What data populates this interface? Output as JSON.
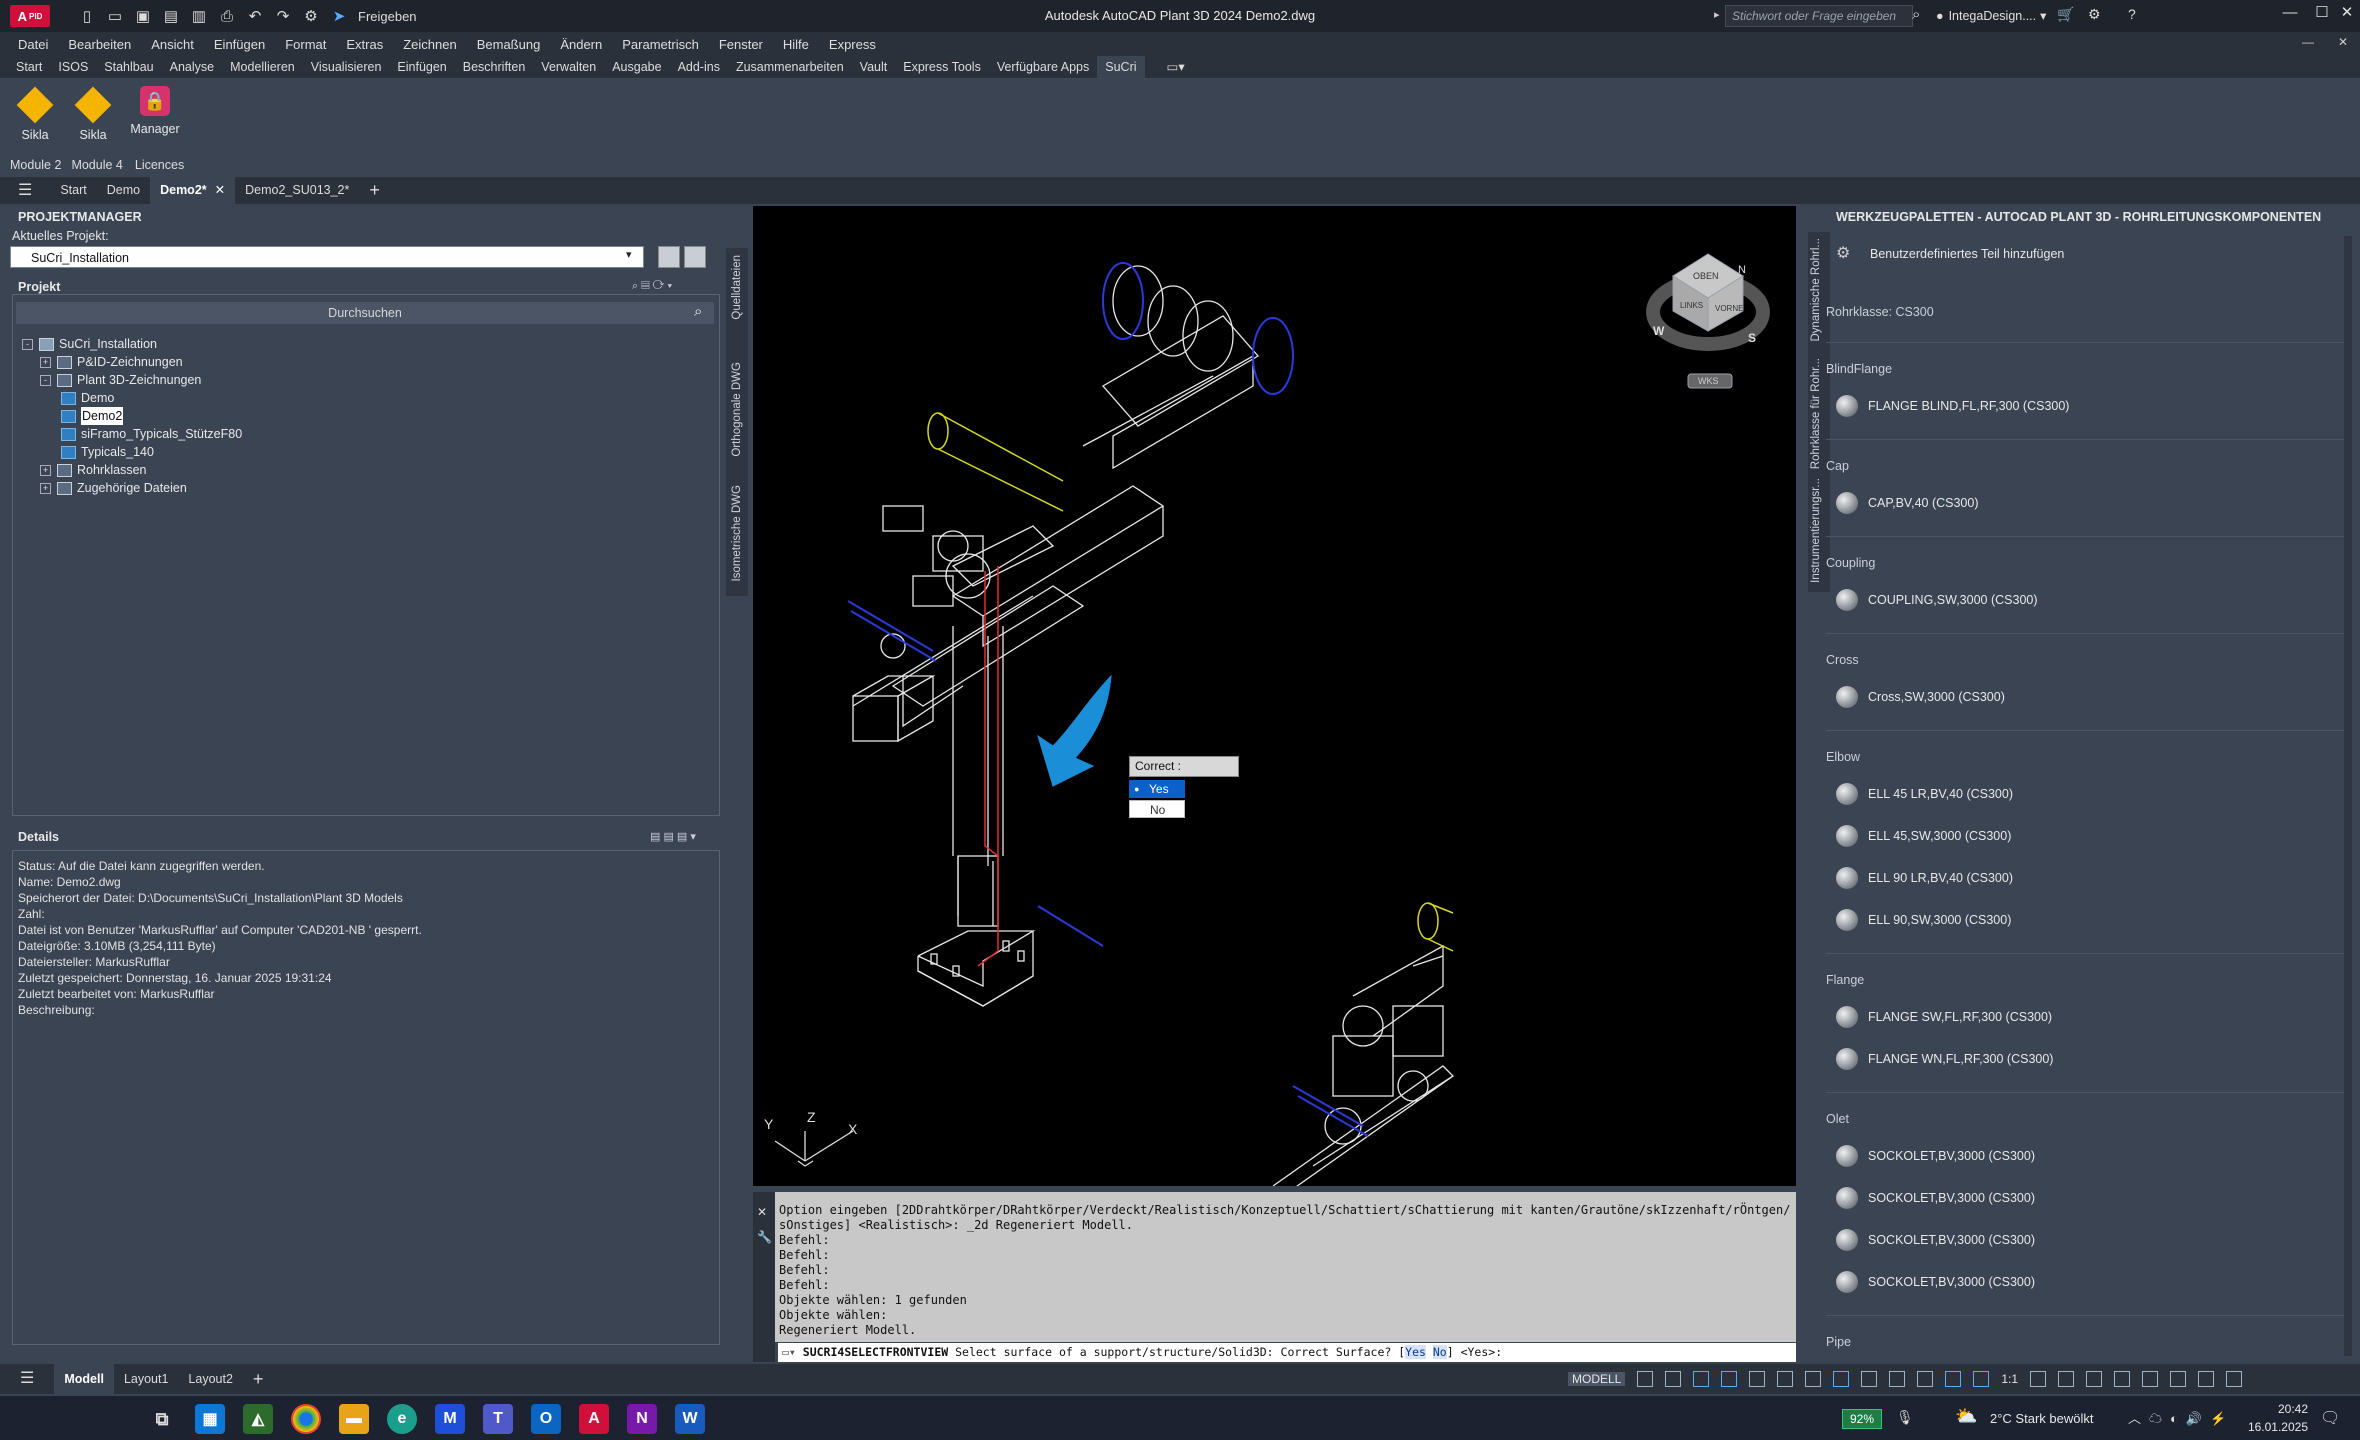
{
  "app": {
    "logo_text": "A",
    "logo_sub": "PID",
    "title": "Autodesk AutoCAD Plant 3D 2024    Demo2.dwg",
    "share_label": "Freigeben",
    "search_placeholder": "Stichwort oder Frage eingeben",
    "user": "IntegaDesign....",
    "icons": [
      "new-icon",
      "open-icon",
      "save-icon",
      "save-as-icon",
      "publish-icon",
      "print-icon",
      "undo-icon",
      "redo-icon",
      "workspace-icon",
      "share-icon"
    ]
  },
  "menubar": [
    "Datei",
    "Bearbeiten",
    "Ansicht",
    "Einfügen",
    "Format",
    "Extras",
    "Zeichnen",
    "Bemaßung",
    "Ändern",
    "Parametrisch",
    "Fenster",
    "Hilfe",
    "Express"
  ],
  "ribbon_tabs": [
    "Start",
    "ISOS",
    "Stahlbau",
    "Analyse",
    "Modellieren",
    "Visualisieren",
    "Einfügen",
    "Beschriften",
    "Verwalten",
    "Ausgabe",
    "Add-ins",
    "Zusammenarbeiten",
    "Vault",
    "Express Tools",
    "Verfügbare Apps",
    "SuCri"
  ],
  "ribbon_active": "SuCri",
  "ribbon_buttons": [
    "Sikla",
    "Sikla",
    "Manager"
  ],
  "ribbon_panels": [
    "Module 2",
    "Module 4",
    "Licences"
  ],
  "file_tabs": [
    "Start",
    "Demo",
    "Demo2*",
    "Demo2_SU013_2*"
  ],
  "file_tab_active": "Demo2*",
  "project_manager": {
    "title": "PROJEKTMANAGER",
    "current_project_label": "Aktuelles Projekt:",
    "current_project": "SuCri_Installation",
    "project_label": "Projekt",
    "search_label": "Durchsuchen",
    "tree": [
      {
        "label": "SuCri_Installation",
        "level": 0,
        "exp": "-",
        "icon": "proj"
      },
      {
        "label": "P&ID-Zeichnungen",
        "level": 1,
        "exp": "+",
        "icon": "folder"
      },
      {
        "label": "Plant 3D-Zeichnungen",
        "level": 1,
        "exp": "-",
        "icon": "folder"
      },
      {
        "label": "Demo",
        "level": 2,
        "exp": "",
        "icon": "dwg"
      },
      {
        "label": "Demo2",
        "level": 2,
        "exp": "",
        "icon": "dwg"
      },
      {
        "label": "siFramo_Typicals_StützeF80",
        "level": 2,
        "exp": "",
        "icon": "dwg"
      },
      {
        "label": "Typicals_140",
        "level": 2,
        "exp": "",
        "icon": "dwg"
      },
      {
        "label": "Rohrklassen",
        "level": 1,
        "exp": "+",
        "icon": "folder"
      },
      {
        "label": "Zugehörige Dateien",
        "level": 1,
        "exp": "+",
        "icon": "folder"
      }
    ],
    "details_label": "Details",
    "details": [
      "Status: Auf die Datei kann zugegriffen werden.",
      "Name:  Demo2.dwg",
      "Speicherort der Datei:  D:\\Documents\\SuCri_Installation\\Plant 3D Models",
      "Zahl:",
      "Datei ist von Benutzer 'MarkusRufflar' auf Computer 'CAD201-NB ' gesperrt.",
      "Dateigröße: 3.10MB (3,254,111 Byte)",
      "Dateiersteller:  MarkusRufflar",
      "Zuletzt gespeichert: Donnerstag, 16. Januar 2025 19:31:24",
      "Zuletzt bearbeitet von:  MarkusRufflar",
      "Beschreibung:"
    ],
    "side_tabs": [
      "Quelldateien",
      "Orthogonale DWG",
      "Isometrische DWG"
    ]
  },
  "viewcube": {
    "top": "OBEN",
    "left": "LINKS",
    "front": "VORNE",
    "n": "N",
    "w": "W",
    "s": "S",
    "wcs": "WKS"
  },
  "ucs": {
    "x": "X",
    "y": "Y",
    "z": "Z"
  },
  "popup": {
    "title": "Correct :",
    "yes": "Yes",
    "no": "No"
  },
  "command": {
    "lines": [
      "Option eingeben [2DDrahtkörper/DRahtkörper/Verdeckt/Realistisch/Konzeptuell/Schattiert/sChattierung mit kanten/Grautöne/skIzzenhaft/rÖntgen/",
      "sOnstiges] <Realistisch>: _2d Regeneriert Modell.",
      "Befehl:",
      "Befehl:",
      "Befehl:",
      "Befehl:",
      "Objekte wählen: 1 gefunden",
      "Objekte wählen:",
      "Regeneriert Modell."
    ],
    "prompt_cmd": "SUCRI4SELECTFRONTVIEW",
    "prompt_text": " Select surface of a support/structure/Solid3D: Correct Surface? [",
    "prompt_opt1": "Yes",
    "prompt_opt2": "No",
    "prompt_end": "] <Yes>:"
  },
  "tool_palette": {
    "title": "WERKZEUGPALETTEN - AUTOCAD PLANT 3D - ROHRLEITUNGSKOMPONENTEN",
    "add_custom": "Benutzerdefiniertes Teil hinzufügen",
    "pipe_class": "Rohrklasse: CS300",
    "side_tabs": [
      "Dynamische Rohrl...",
      "Rohrklasse für Rohr...",
      "Instrumentierungsr..."
    ],
    "sections": [
      {
        "name": "BlindFlange",
        "items": [
          "FLANGE BLIND,FL,RF,300 (CS300)"
        ]
      },
      {
        "name": "Cap",
        "items": [
          "CAP,BV,40 (CS300)"
        ]
      },
      {
        "name": "Coupling",
        "items": [
          "COUPLING,SW,3000 (CS300)"
        ]
      },
      {
        "name": "Cross",
        "items": [
          "Cross,SW,3000 (CS300)"
        ]
      },
      {
        "name": "Elbow",
        "items": [
          "ELL 45 LR,BV,40 (CS300)",
          "ELL 45,SW,3000 (CS300)",
          "ELL 90 LR,BV,40 (CS300)",
          "ELL 90,SW,3000 (CS300)"
        ]
      },
      {
        "name": "Flange",
        "items": [
          "FLANGE SW,FL,RF,300 (CS300)",
          "FLANGE WN,FL,RF,300 (CS300)"
        ]
      },
      {
        "name": "Olet",
        "items": [
          "SOCKOLET,BV,3000 (CS300)",
          "SOCKOLET,BV,3000 (CS300)",
          "SOCKOLET,BV,3000 (CS300)",
          "SOCKOLET,BV,3000 (CS300)"
        ]
      },
      {
        "name": "Pipe",
        "items": []
      }
    ]
  },
  "statusbar": {
    "tabs": [
      "Modell",
      "Layout1",
      "Layout2"
    ],
    "active": "Modell",
    "model_label": "MODELL",
    "scale": "1:1"
  },
  "taskbar": {
    "battery": "92%",
    "weather": "2°C  Stark bewölkt",
    "time": "20:42",
    "date": "16.01.2025",
    "apps": [
      "task-view",
      "store",
      "apps",
      "chrome",
      "explorer",
      "edge",
      "m-app",
      "teams",
      "outlook",
      "autocad",
      "onenote",
      "word"
    ]
  },
  "colors": {
    "accent": "#0b61c9",
    "autocad_red": "#d0103a",
    "sikla_yellow": "#f4b400",
    "viewport": "#000000",
    "panel": "#3b4453"
  }
}
